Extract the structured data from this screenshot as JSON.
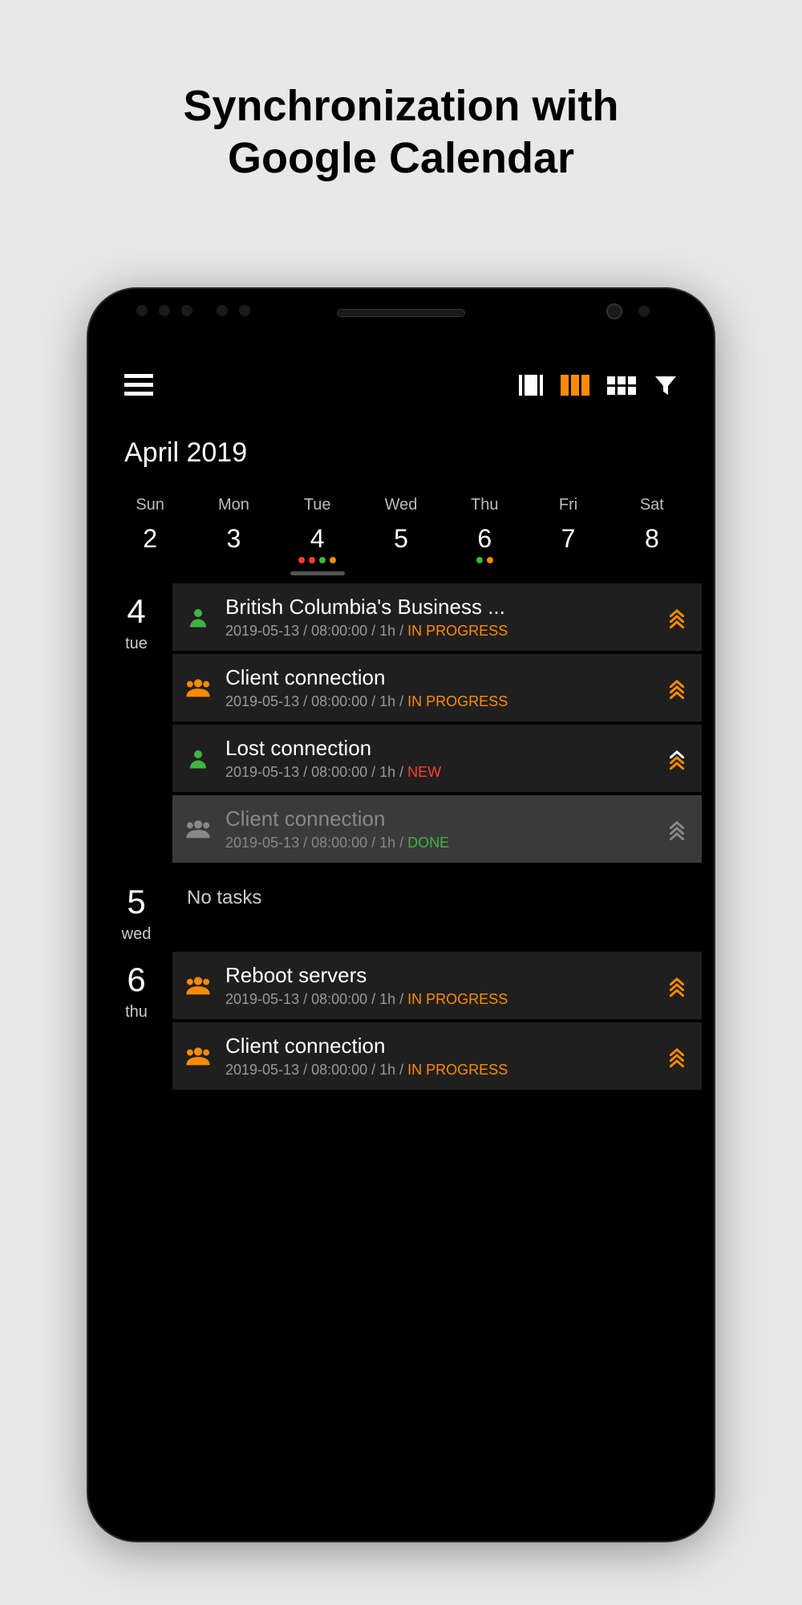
{
  "heading_line1": "Synchronization with",
  "heading_line2": "Google Calendar",
  "month_label": "April 2019",
  "week": {
    "labels": [
      "Sun",
      "Mon",
      "Tue",
      "Wed",
      "Thu",
      "Fri",
      "Sat"
    ],
    "nums": [
      "2",
      "3",
      "4",
      "5",
      "6",
      "7",
      "8"
    ],
    "dots": {
      "2": [
        "red",
        "red",
        "green",
        "orange"
      ],
      "4": [
        "green",
        "orange"
      ]
    },
    "underline_index": 2
  },
  "notasks_label": "No tasks",
  "days": [
    {
      "num": "4",
      "wkd": "tue",
      "tasks": [
        {
          "icon": "person",
          "icon_color": "#3fb43f",
          "title": "British Columbia's Business ...",
          "date": "2019-05-13",
          "time": "08:00:00",
          "dur": "1h",
          "status_label": "IN PROGRESS",
          "status": "inprogress",
          "priority": [
            "orange",
            "orange",
            "orange"
          ],
          "done": false
        },
        {
          "icon": "group",
          "icon_color": "#ff8a00",
          "title": "Client connection",
          "date": "2019-05-13",
          "time": "08:00:00",
          "dur": "1h",
          "status_label": "IN PROGRESS",
          "status": "inprogress",
          "priority": [
            "orange",
            "orange",
            "orange"
          ],
          "done": false
        },
        {
          "icon": "person",
          "icon_color": "#3fb43f",
          "title": "Lost connection",
          "date": "2019-05-13",
          "time": "08:00:00",
          "dur": "1h",
          "status_label": "NEW",
          "status": "new",
          "priority": [
            "white",
            "orange",
            "orange"
          ],
          "done": false
        },
        {
          "icon": "group",
          "icon_color": "#888",
          "title": "Client connection",
          "date": "2019-05-13",
          "time": "08:00:00",
          "dur": "1h",
          "status_label": "DONE",
          "status": "done",
          "priority": [
            "grey",
            "grey",
            "grey"
          ],
          "done": true
        }
      ]
    },
    {
      "num": "5",
      "wkd": "wed",
      "tasks": []
    },
    {
      "num": "6",
      "wkd": "thu",
      "tasks": [
        {
          "icon": "group",
          "icon_color": "#ff8a00",
          "title": "Reboot servers",
          "date": "2019-05-13",
          "time": "08:00:00",
          "dur": "1h",
          "status_label": "IN PROGRESS",
          "status": "inprogress",
          "priority": [
            "orange",
            "orange",
            "orange"
          ],
          "done": false
        },
        {
          "icon": "group",
          "icon_color": "#ff8a00",
          "title": "Client connection",
          "date": "2019-05-13",
          "time": "08:00:00",
          "dur": "1h",
          "status_label": "IN PROGRESS",
          "status": "inprogress",
          "priority": [
            "orange",
            "orange",
            "orange"
          ],
          "done": false
        }
      ]
    }
  ]
}
